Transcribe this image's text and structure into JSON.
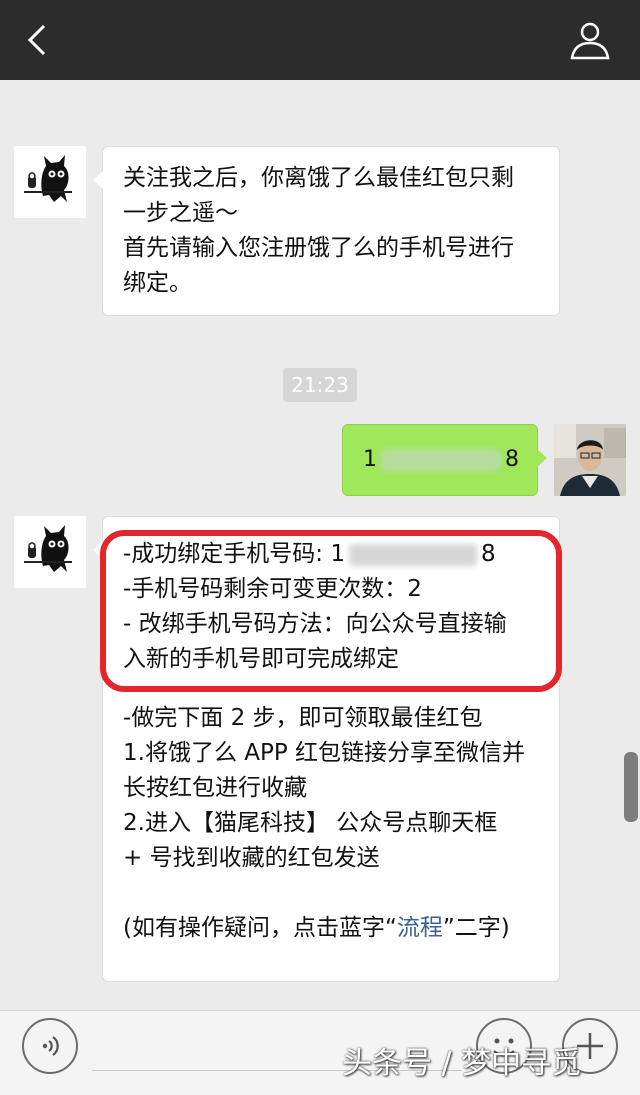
{
  "header": {
    "back_icon": "chevron-left-icon",
    "profile_icon": "person-outline-icon"
  },
  "messages": [
    {
      "sender": "bot",
      "lines": [
        "关注我之后，你离饿了么最佳红包只剩",
        "一步之遥～",
        "首先请输入您注册饿了么的手机号进行",
        "绑定。"
      ]
    },
    {
      "time": "21:23"
    },
    {
      "sender": "user",
      "phone_first": "1",
      "phone_last": "8"
    },
    {
      "sender": "bot",
      "boxed_lines": {
        "l1_prefix": "-成功绑定手机号码: 1",
        "l1_suffix": "8",
        "l2": "-手机号码剩余可变更次数：2",
        "l3": "- 改绑手机号码方法：向公众号直接输",
        "l4": "入新的手机号即可完成绑定"
      },
      "lines": [
        "-做完下面 2 步，即可领取最佳红包",
        "1.将饿了么 APP 红包链接分享至微信并",
        "长按红包进行收藏",
        "2.进入【猫尾科技】 公众号点聊天框",
        "+ 号找到收藏的红包发送"
      ],
      "footer_prefix": "(如有操作疑问，点击蓝字“",
      "footer_link": "流程",
      "footer_suffix": "”二字)"
    }
  ],
  "bottom": {
    "voice_icon": "voice-icon",
    "emoji_icon": "emoji-icon",
    "plus_icon": "plus-icon"
  },
  "watermark": "头条号 / 梦中寻觅",
  "colors": {
    "topbar": "#2c2c2c",
    "background": "#ebebeb",
    "outgoing_bubble": "#a0e75a",
    "highlight": "#e2262c",
    "link": "#3b5f96"
  }
}
